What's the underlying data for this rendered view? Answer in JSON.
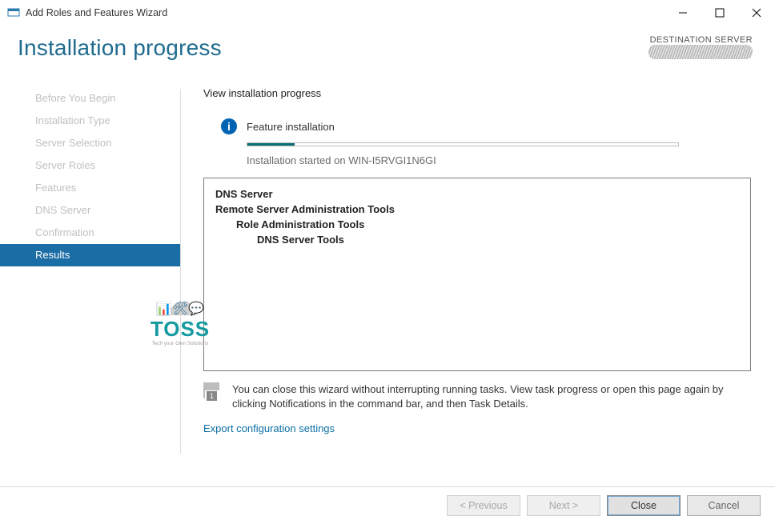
{
  "window": {
    "title": "Add Roles and Features Wizard"
  },
  "header": {
    "page_title": "Installation progress",
    "destination_label": "DESTINATION SERVER"
  },
  "sidebar": {
    "items": [
      {
        "label": "Before You Begin",
        "active": false
      },
      {
        "label": "Installation Type",
        "active": false
      },
      {
        "label": "Server Selection",
        "active": false
      },
      {
        "label": "Server Roles",
        "active": false
      },
      {
        "label": "Features",
        "active": false
      },
      {
        "label": "DNS Server",
        "active": false
      },
      {
        "label": "Confirmation",
        "active": false
      },
      {
        "label": "Results",
        "active": true
      }
    ]
  },
  "main": {
    "view_label": "View installation progress",
    "feature_installation_label": "Feature installation",
    "progress_percent": 11,
    "install_started_text": "Installation started on WIN-I5RVGI1N6GI",
    "features": {
      "line0": "DNS Server",
      "line1": "Remote Server Administration Tools",
      "line2": "Role Administration Tools",
      "line3": "DNS Server Tools"
    },
    "tip_text": "You can close this wizard without interrupting running tasks. View task progress or open this page again by clicking Notifications in the command bar, and then Task Details.",
    "tip_badge": "1",
    "export_link": "Export configuration settings"
  },
  "footer": {
    "previous": "< Previous",
    "next": "Next >",
    "close": "Close",
    "cancel": "Cancel"
  },
  "watermark": {
    "brand": "TOSS",
    "tagline": "Tech your Own Solutions"
  }
}
